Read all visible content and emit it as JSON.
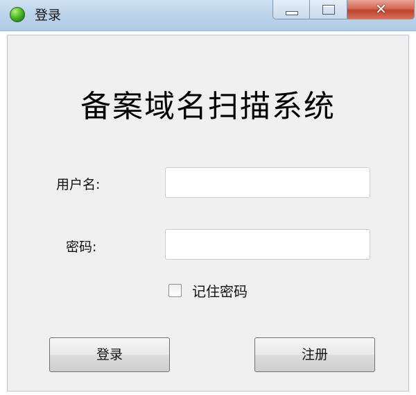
{
  "window": {
    "title": "登录",
    "icon": "app-icon",
    "controls": {
      "minimize_icon": "minimize-icon",
      "maximize_icon": "maximize-icon",
      "close_glyph": "✕"
    }
  },
  "form": {
    "heading": "备案域名扫描系统",
    "username_label": "用户名:",
    "username_value": "",
    "password_label": "密码:",
    "password_value": "",
    "remember_label": "记住密码",
    "remember_checked": false
  },
  "buttons": {
    "login": "登录",
    "register": "注册"
  },
  "colors": {
    "close_button": "#c0412a",
    "client_bg": "#f0f0f0",
    "titlebar": "#bdd4ea"
  }
}
